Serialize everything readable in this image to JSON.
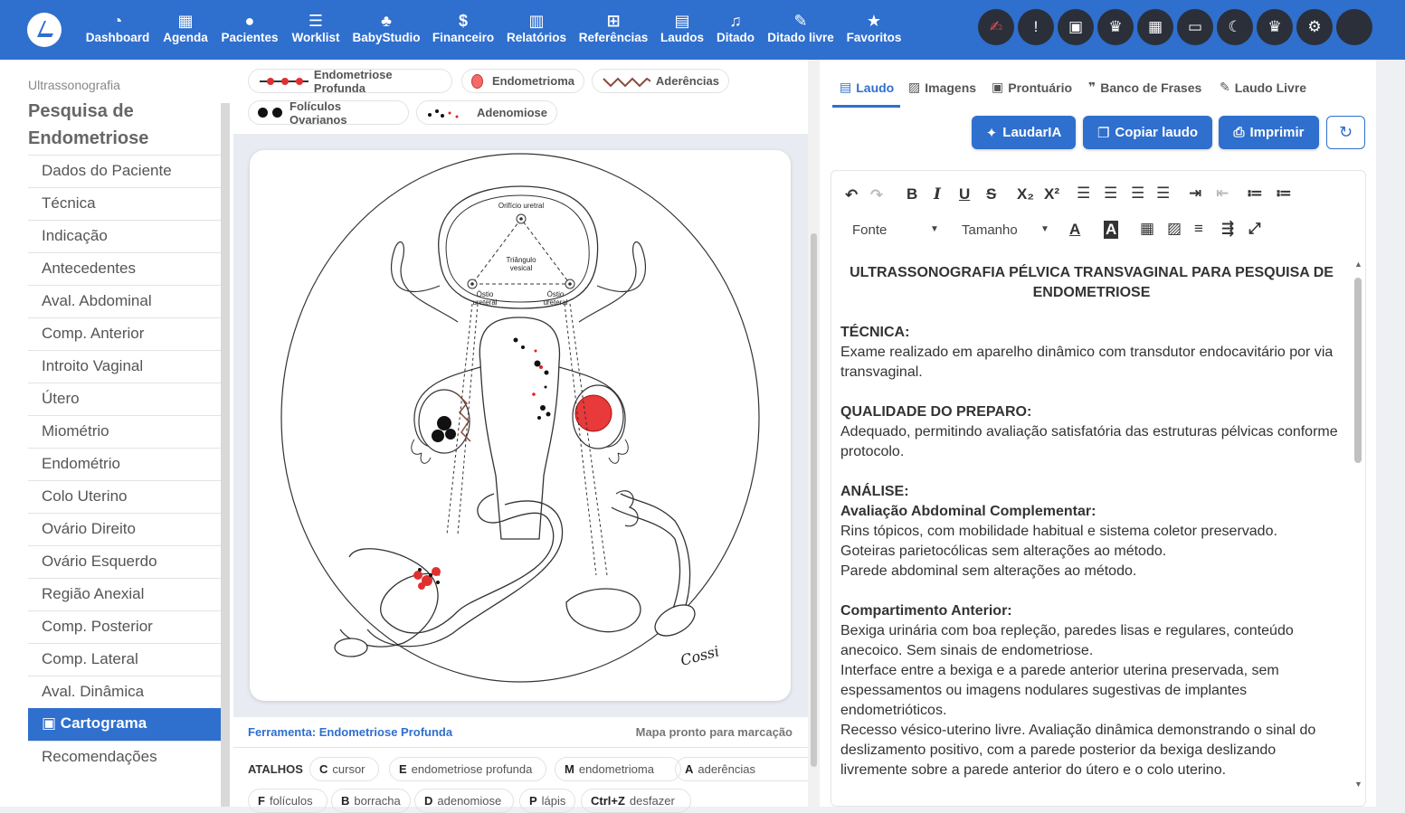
{
  "nav": [
    {
      "label": "Dashboard",
      "icon": "dashboard-icon",
      "glyph": "◔"
    },
    {
      "label": "Agenda",
      "icon": "calendar-icon",
      "glyph": "▦"
    },
    {
      "label": "Pacientes",
      "icon": "user-icon",
      "glyph": "●"
    },
    {
      "label": "Worklist",
      "icon": "checklist-icon",
      "glyph": "☰"
    },
    {
      "label": "BabyStudio",
      "icon": "baby-icon",
      "glyph": "♣"
    },
    {
      "label": "Financeiro",
      "icon": "dollar-icon",
      "glyph": "$"
    },
    {
      "label": "Relatórios",
      "icon": "bar-chart-icon",
      "glyph": "▥"
    },
    {
      "label": "Referências",
      "icon": "plus-square-icon",
      "glyph": "⊞"
    },
    {
      "label": "Laudos",
      "icon": "file-icon",
      "glyph": "▤"
    },
    {
      "label": "Ditado",
      "icon": "microphone-icon",
      "glyph": "♫"
    },
    {
      "label": "Ditado livre",
      "icon": "feather-icon",
      "glyph": "✎"
    },
    {
      "label": "Favoritos",
      "icon": "star-icon",
      "glyph": "★"
    }
  ],
  "top_icons": [
    {
      "name": "signature-icon",
      "glyph": "✍",
      "color": "#e05050"
    },
    {
      "name": "alert-icon",
      "glyph": "!"
    },
    {
      "name": "clipboard-icon",
      "glyph": "▣"
    },
    {
      "name": "crown-icon",
      "glyph": "♛"
    },
    {
      "name": "building-icon",
      "glyph": "▦"
    },
    {
      "name": "ticket-icon",
      "glyph": "▭"
    },
    {
      "name": "moon-icon",
      "glyph": "☾"
    },
    {
      "name": "crown-icon",
      "glyph": "♛"
    },
    {
      "name": "gear-icon",
      "glyph": "⚙"
    },
    {
      "name": "avatar",
      "glyph": ""
    }
  ],
  "sidebar": {
    "subtitle": "Ultrassonografia",
    "title": "Pesquisa de Endometriose",
    "items": [
      "Dados do Paciente",
      "Técnica",
      "Indicação",
      "Antecedentes",
      "Aval. Abdominal",
      "Comp. Anterior",
      "Introito Vaginal",
      "Útero",
      "Miométrio",
      "Endométrio",
      "Colo Uterino",
      "Ovário Direito",
      "Ovário Esquerdo",
      "Região Anexial",
      "Comp. Posterior",
      "Comp. Lateral",
      "Aval. Dinâmica",
      "Cartograma",
      "Recomendações"
    ],
    "active": "Cartograma"
  },
  "legend": {
    "deep": "Endometriose Profunda",
    "endometrioma": "Endometrioma",
    "adhesions": "Aderências",
    "follicles": "Folículos Ovarianos",
    "adenomyosis": "Adenomiose"
  },
  "diagram": {
    "urethral_orifice": "Orifício uretral",
    "trigone_1": "Triângulo",
    "trigone_2": "vesical",
    "ureteral_l1": "Óstio",
    "ureteral_l2": "ureteral",
    "signature": "Cossi"
  },
  "status": {
    "tool": "Ferramenta: Endometriose Profunda",
    "map": "Mapa pronto para marcação"
  },
  "shortcuts": {
    "title": "ATALHOS",
    "keys": [
      {
        "k": "C",
        "v": "cursor"
      },
      {
        "k": "E",
        "v": "endometriose profunda"
      },
      {
        "k": "M",
        "v": "endometrioma"
      },
      {
        "k": "A",
        "v": "aderências"
      },
      {
        "k": "F",
        "v": "folículos"
      },
      {
        "k": "B",
        "v": "borracha"
      },
      {
        "k": "D",
        "v": "adenomiose"
      },
      {
        "k": "P",
        "v": "lápis"
      },
      {
        "k": "Ctrl+Z",
        "v": "desfazer"
      }
    ]
  },
  "tabs": [
    "Laudo",
    "Imagens",
    "Prontuário",
    "Banco de Frases",
    "Laudo Livre"
  ],
  "buttons": {
    "laudaria": "LaudarIA",
    "copy": "Copiar laudo",
    "print": "Imprimir"
  },
  "editor_toolbar": {
    "font": "Fonte",
    "size": "Tamanho"
  },
  "report": {
    "title": "ULTRASSONOGRAFIA PÉLVICA TRANSVAGINAL PARA PESQUISA DE ENDOMETRIOSE",
    "s1_h": "TÉCNICA:",
    "s1_t": "Exame realizado em aparelho dinâmico com transdutor endocavitário por via transvaginal.",
    "s2_h": "QUALIDADE DO PREPARO:",
    "s2_t": "Adequado, permitindo avaliação satisfatória das estruturas pélvicas conforme protocolo.",
    "s3_h": "ANÁLISE:",
    "s3_sub": "Avaliação Abdominal Complementar:",
    "s3_l1": "Rins tópicos, com mobilidade habitual e sistema coletor preservado.",
    "s3_l2": "Goteiras parietocólicas sem alterações ao método.",
    "s3_l3": "Parede abdominal sem alterações ao método.",
    "s4_h": "Compartimento Anterior:",
    "s4_l1": "Bexiga urinária com boa repleção, paredes lisas e regulares, conteúdo anecoico. Sem sinais de endometriose.",
    "s4_l2": "Interface entre a bexiga e a parede anterior uterina preservada, sem espessamentos ou imagens nodulares sugestivas de implantes endometrióticos.",
    "s4_l3": "Recesso vésico-uterino livre. Avaliação dinâmica demonstrando o sinal do deslizamento positivo, com a parede posterior da bexiga deslizando livremente sobre a parede anterior do útero e o colo uterino."
  }
}
